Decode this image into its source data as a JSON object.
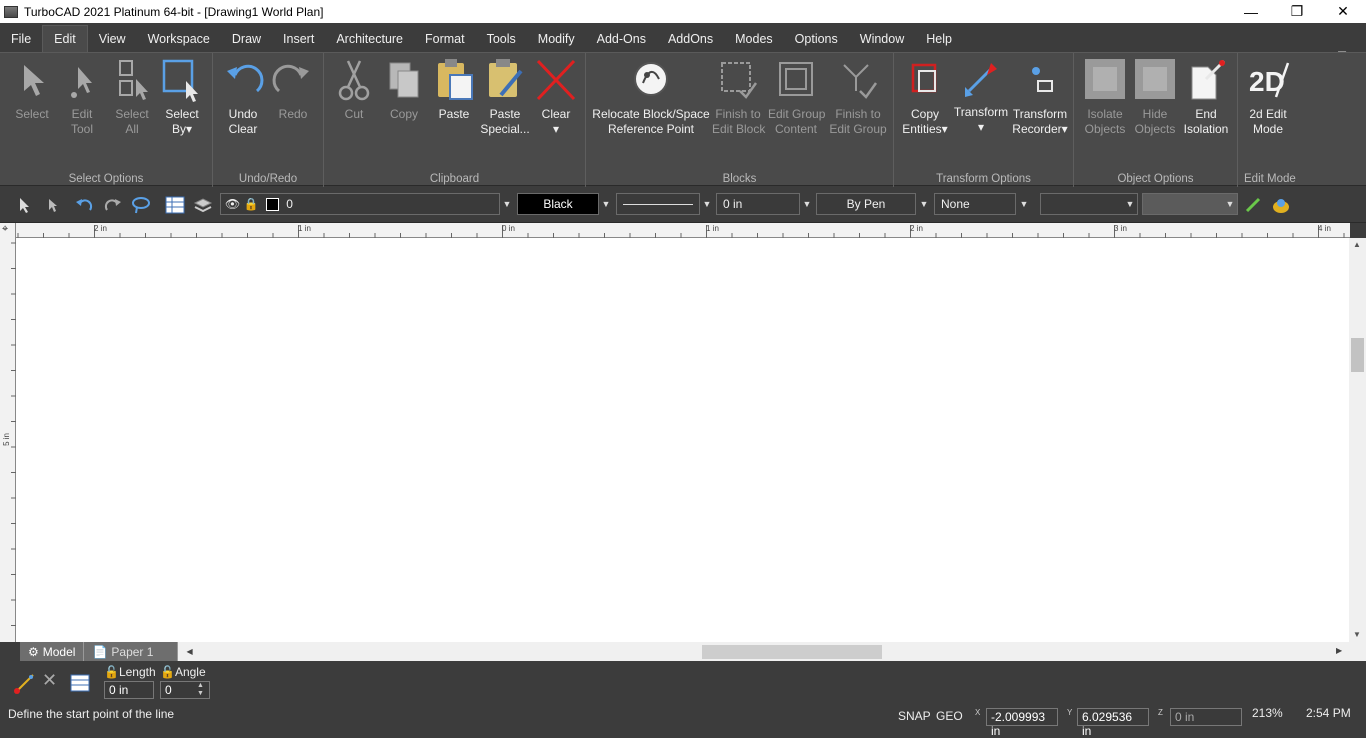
{
  "window": {
    "title": "TurboCAD 2021 Platinum 64-bit - [Drawing1 World Plan]",
    "controls": [
      "minimize",
      "restore",
      "close"
    ]
  },
  "menu": {
    "items": [
      "File",
      "Edit",
      "View",
      "Workspace",
      "Draw",
      "Insert",
      "Architecture",
      "Format",
      "Tools",
      "Modify",
      "Add-Ons",
      "AddOns",
      "Modes",
      "Options",
      "Window",
      "Help"
    ],
    "active": "Edit"
  },
  "ribbon": {
    "groups": {
      "select_options": "Select Options",
      "undo_redo": "Undo/Redo",
      "clipboard": "Clipboard",
      "blocks": "Blocks",
      "transform_options": "Transform Options",
      "object_options": "Object Options",
      "edit_mode": "Edit Mode"
    },
    "buttons": {
      "select": [
        "Select",
        ""
      ],
      "edit_tool": [
        "Edit",
        "Tool"
      ],
      "select_all": [
        "Select",
        "All"
      ],
      "select_by": [
        "Select",
        "By"
      ],
      "undo": [
        "Undo",
        "Clear"
      ],
      "redo": [
        "Redo",
        ""
      ],
      "cut": [
        "Cut",
        ""
      ],
      "copy": [
        "Copy",
        ""
      ],
      "paste": [
        "Paste",
        ""
      ],
      "paste_special": [
        "Paste",
        "Special..."
      ],
      "clear": [
        "Clear",
        ""
      ],
      "relocate_block": [
        "Relocate Block/Space",
        "Reference Point"
      ],
      "finish_edit_block": [
        "Finish to",
        "Edit Block"
      ],
      "edit_group_content": [
        "Edit Group",
        "Content"
      ],
      "finish_edit_group": [
        "Finish to",
        "Edit Group"
      ],
      "copy_entities": [
        "Copy",
        "Entities"
      ],
      "transform": [
        "Transform",
        ""
      ],
      "transform_recorder": [
        "Transform",
        "Recorder"
      ],
      "isolate_objects": [
        "Isolate",
        "Objects"
      ],
      "hide_objects": [
        "Hide",
        "Objects"
      ],
      "end_isolation": [
        "End",
        "Isolation"
      ],
      "edit_mode_2d": [
        "2d Edit",
        "Mode"
      ]
    }
  },
  "toolbar": {
    "layer_value": "0",
    "color_value": "Black",
    "line_width_value": "0 in",
    "pen_value": "By Pen",
    "pattern_value": "None"
  },
  "ruler": {
    "h_ticks": [
      "2 in",
      "1 in",
      "0 in",
      "1 in",
      "2 in",
      "3 in",
      "4 in"
    ],
    "v_tick": "5 in"
  },
  "tabs": [
    "Model",
    "Paper 1"
  ],
  "inspector": {
    "length_label": "Length",
    "length_value": "0 in",
    "angle_label": "Angle",
    "angle_value": "0"
  },
  "status": {
    "message": "Define the start point of the line",
    "snap": "SNAP",
    "geo": "GEO",
    "x_label": "X",
    "x_value": "-2.009993 in",
    "y_label": "Y",
    "y_value": "6.029536 in",
    "z_label": "Z",
    "z_value": "0 in",
    "zoom": "213%",
    "time": "2:54 PM"
  },
  "colors": {
    "chrome": "#3c3c3c",
    "ribbon": "#4a4a4a",
    "canvas": "#ffffff",
    "accent_blue": "#5aa0e6",
    "accent_red": "#e02020"
  }
}
